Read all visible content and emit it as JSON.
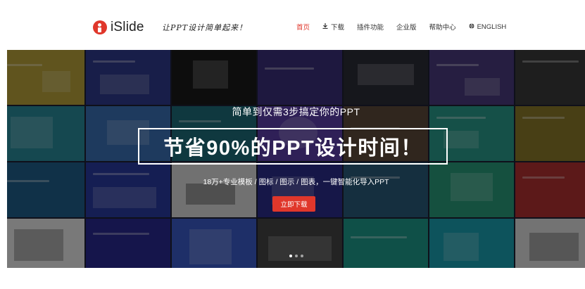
{
  "header": {
    "logo_text": "iSlide",
    "slogan": "让PPT设计简单起来！",
    "nav": [
      {
        "label": "首页",
        "icon": "",
        "active": true
      },
      {
        "label": "下载",
        "icon": "download-icon",
        "active": false
      },
      {
        "label": "插件功能",
        "icon": "",
        "active": false
      },
      {
        "label": "企业版",
        "icon": "",
        "active": false
      },
      {
        "label": "帮助中心",
        "icon": "",
        "active": false
      },
      {
        "label": "ENGLISH",
        "icon": "globe-icon",
        "active": false
      }
    ]
  },
  "hero": {
    "subtitle": "简单到仅需3步搞定你的PPT",
    "title": "节省90%的PPT设计时间！",
    "description": "18万+专业模板 / 图标 / 图示 / 图表，一键智能化导入PPT",
    "cta_label": "立即下载",
    "slides_count": 3,
    "active_slide": 1
  },
  "colors": {
    "accent": "#e0372b",
    "header_bg": "#ffffff",
    "overlay": "#000000"
  }
}
